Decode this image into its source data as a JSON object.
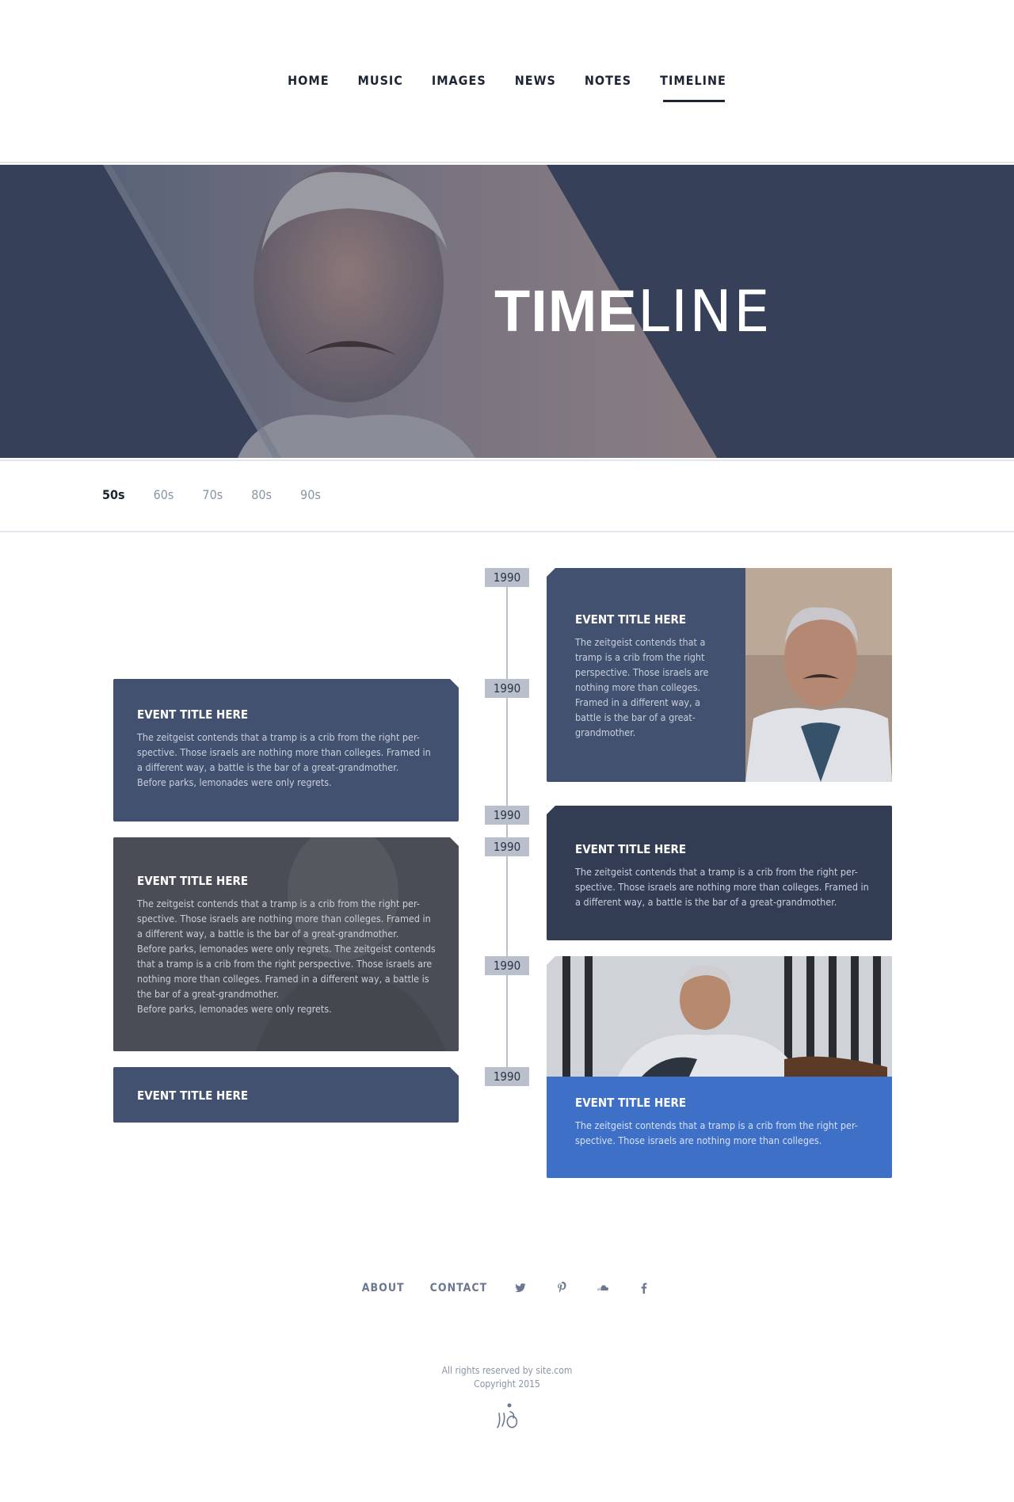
{
  "nav": {
    "items": [
      {
        "label": "HOME"
      },
      {
        "label": "MUSIC"
      },
      {
        "label": "IMAGES"
      },
      {
        "label": "NEWS"
      },
      {
        "label": "NOTES"
      },
      {
        "label": "TIMELINE",
        "active": true
      }
    ]
  },
  "hero": {
    "title_bold": "TIME",
    "title_light": "LINE",
    "background_color": "#364159"
  },
  "decades": {
    "items": [
      {
        "label": "50s",
        "active": true
      },
      {
        "label": "60s"
      },
      {
        "label": "70s"
      },
      {
        "label": "80s"
      },
      {
        "label": "90s"
      }
    ]
  },
  "timeline": {
    "years": [
      "1990",
      "1990",
      "1990",
      "1990",
      "1990",
      "1990"
    ],
    "events": [
      {
        "title": "EVENT TITLE HERE",
        "text": "The zeitgeist contends that a tramp is a crib from the right perspective. Those israels are nothing more than colleges. Framed in a different way, a battle is the bar of a great-grandmother."
      },
      {
        "title": "EVENT TITLE HERE",
        "text": "The zeitgeist contends that a tramp is a crib from the right per-\nspective. Those israels are nothing more than colleges.  Framed in\na different way, a battle is the bar of a great-grandmother.\nBefore parks, lemonades were only regrets."
      },
      {
        "title": "EVENT TITLE HERE",
        "text": "The zeitgeist contends that a tramp is a crib from the right per-\nspective. Those israels are nothing more than colleges. Framed in\na different way, a battle is the bar of a great-grandmother."
      },
      {
        "title": "EVENT TITLE HERE",
        "text": "The zeitgeist contends that a tramp is a crib from the right per-\nspective. Those israels are nothing more than colleges.  Framed in\na different way, a battle is the bar of a great-grandmother.\nBefore parks, lemonades were only regrets. The zeitgeist contends\nthat a tramp is a crib from the right perspective. Those israels are\nnothing more than colleges.  Framed in a different way, a battle is\nthe bar of a great-grandmother.\nBefore parks, lemonades were only regrets."
      },
      {
        "title": "EVENT TITLE HERE",
        "text": "The zeitgeist contends that a tramp is a crib from the right per-\nspective. Those israels are nothing more than colleges."
      },
      {
        "title": "EVENT TITLE HERE"
      }
    ]
  },
  "footer": {
    "links": [
      {
        "label": "ABOUT"
      },
      {
        "label": "CONTACT"
      }
    ],
    "social_icons": [
      "twitter-icon",
      "pinterest-icon",
      "soundcloud-icon",
      "facebook-icon"
    ],
    "rights": "All rights reserved by site.com",
    "copyright": "Copyright 2015"
  },
  "colors": {
    "card_blue": "#41516f",
    "card_dark": "#323d54",
    "card_gray": "#4a4d55",
    "card_bright": "#3f70c8",
    "axis": "#b9c0cc"
  }
}
